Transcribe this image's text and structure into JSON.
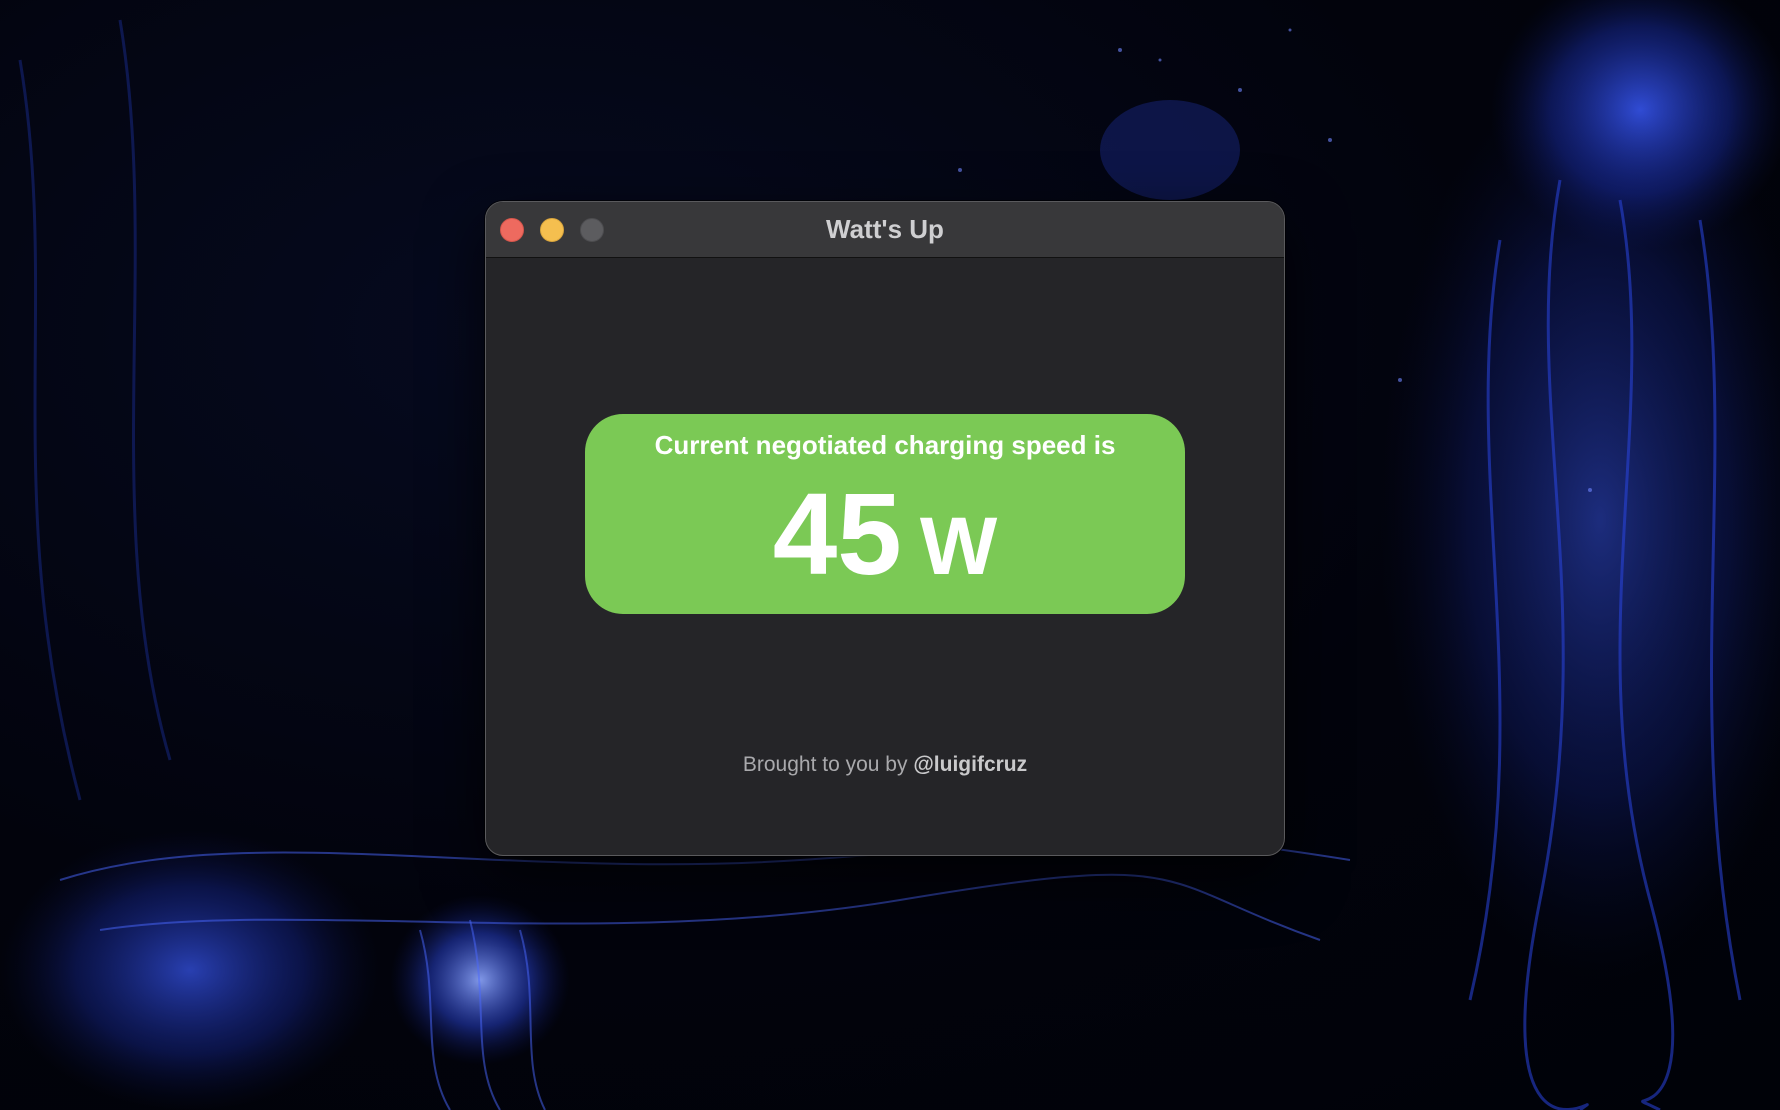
{
  "colors": {
    "card_background": "#7bc955",
    "window_background": "#252528",
    "titlebar_background": "#38383a",
    "close_button": "#ee6a5f",
    "minimize_button": "#f5bf4f",
    "zoom_button_disabled": "#5c5c5f"
  },
  "window": {
    "title": "Watt's Up",
    "controls": [
      "close",
      "minimize",
      "zoom"
    ]
  },
  "charging": {
    "caption": "Current negotiated charging speed is",
    "value": "45",
    "unit": "W"
  },
  "footer": {
    "prefix": "Brought to you by",
    "handle": "@luigifcruz"
  }
}
